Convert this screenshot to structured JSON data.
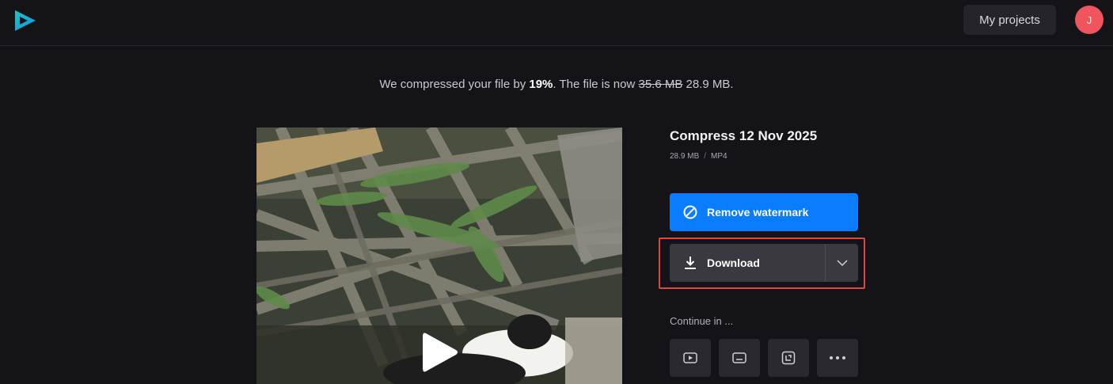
{
  "header": {
    "logo": "play-logo",
    "my_projects_label": "My projects",
    "avatar_initial": "J"
  },
  "summary": {
    "prefix": "We compressed your file by ",
    "percent": "19%",
    "middle": ". The file is now ",
    "old_size": "35.6 MB",
    "new_size": "28.9 MB",
    "suffix": "."
  },
  "file": {
    "title": "Compress 12 Nov 2025",
    "size": "28.9 MB",
    "separator": "/",
    "format": "MP4"
  },
  "actions": {
    "remove_watermark_label": "Remove watermark",
    "download_label": "Download"
  },
  "continue": {
    "label": "Continue in ...",
    "icons": [
      "youtube-icon",
      "subtitles-icon",
      "crop-icon",
      "more-icon"
    ]
  },
  "colors": {
    "background": "#141318",
    "accent": "#0a7cff",
    "highlight": "#e0483f",
    "avatar": "#f0545c"
  }
}
